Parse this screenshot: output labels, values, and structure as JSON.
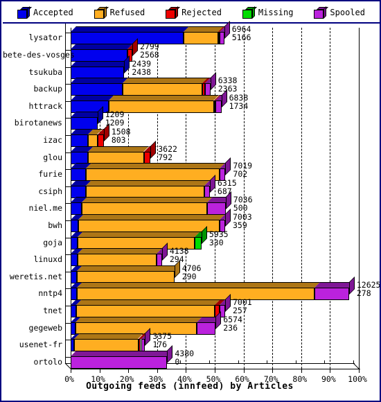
{
  "legend": {
    "items": [
      {
        "label": "Accepted",
        "color": "#0000ee",
        "icon": "cube-icon"
      },
      {
        "label": "Refused",
        "color": "#ffae21",
        "icon": "cube-icon"
      },
      {
        "label": "Rejected",
        "color": "#ee0000",
        "icon": "cube-icon"
      },
      {
        "label": "Missing",
        "color": "#00dd00",
        "icon": "cube-icon"
      },
      {
        "label": "Spooled",
        "color": "#bb22dd",
        "icon": "cube-icon"
      }
    ]
  },
  "chart_data": {
    "type": "bar",
    "orientation": "horizontal",
    "stacked": true,
    "title": "",
    "xlabel": "Outgoing feeds (innfeed) by Articles",
    "ylabel": "",
    "xlim": [
      0,
      100
    ],
    "xunit": "%",
    "grid": true,
    "legend_position": "top",
    "xticks": [
      "0%",
      "10%",
      "20%",
      "30%",
      "40%",
      "50%",
      "60%",
      "70%",
      "80%",
      "90%",
      "100%"
    ],
    "xtick_values": [
      0,
      10,
      20,
      30,
      40,
      50,
      60,
      70,
      80,
      90,
      100
    ],
    "series_names": [
      "Accepted",
      "Refused",
      "Rejected",
      "Missing",
      "Spooled"
    ],
    "categories": [
      "lysator",
      "bete-des-vosges",
      "tsukuba",
      "backup",
      "httrack",
      "birotanews",
      "izac",
      "glou",
      "furie",
      "csiph",
      "niel.me",
      "bwh",
      "goja",
      "linuxd",
      "weretis.net",
      "nntp4",
      "tnet",
      "gegeweb",
      "usenet-fr",
      "ortolo"
    ],
    "rows": [
      {
        "name": "lysator",
        "label_top": "6964",
        "label_bottom": "5166",
        "total_pct": 53.3,
        "segments": [
          {
            "series": "Accepted",
            "pct": 39.1
          },
          {
            "series": "Refused",
            "pct": 12.2
          },
          {
            "series": "Rejected",
            "pct": 0.4
          },
          {
            "series": "Spooled",
            "pct": 1.6
          }
        ]
      },
      {
        "name": "bete-des-vosges",
        "label_top": "2799",
        "label_bottom": "2568",
        "total_pct": 21.4,
        "segments": [
          {
            "series": "Accepted",
            "pct": 19.6
          },
          {
            "series": "Rejected",
            "pct": 1.8
          }
        ]
      },
      {
        "name": "tsukuba",
        "label_top": "2439",
        "label_bottom": "2438",
        "total_pct": 18.6,
        "segments": [
          {
            "series": "Accepted",
            "pct": 18.6
          }
        ]
      },
      {
        "name": "backup",
        "label_top": "6338",
        "label_bottom": "2363",
        "total_pct": 48.5,
        "segments": [
          {
            "series": "Accepted",
            "pct": 18.1
          },
          {
            "series": "Refused",
            "pct": 27.6
          },
          {
            "series": "Rejected",
            "pct": 1.0
          },
          {
            "series": "Spooled",
            "pct": 1.8
          }
        ]
      },
      {
        "name": "httrack",
        "label_top": "6838",
        "label_bottom": "1734",
        "total_pct": 52.3,
        "segments": [
          {
            "series": "Accepted",
            "pct": 13.3
          },
          {
            "series": "Refused",
            "pct": 36.4
          },
          {
            "series": "Rejected",
            "pct": 0.4
          },
          {
            "series": "Spooled",
            "pct": 2.2
          }
        ]
      },
      {
        "name": "birotanews",
        "label_top": "1209",
        "label_bottom": "1209",
        "total_pct": 9.3,
        "segments": [
          {
            "series": "Accepted",
            "pct": 9.3
          }
        ]
      },
      {
        "name": "izac",
        "label_top": "1508",
        "label_bottom": "803",
        "total_pct": 11.5,
        "segments": [
          {
            "series": "Accepted",
            "pct": 6.1
          },
          {
            "series": "Refused",
            "pct": 3.2
          },
          {
            "series": "Rejected",
            "pct": 2.2
          }
        ]
      },
      {
        "name": "glou",
        "label_top": "3622",
        "label_bottom": "792",
        "total_pct": 27.7,
        "segments": [
          {
            "series": "Accepted",
            "pct": 6.1
          },
          {
            "series": "Refused",
            "pct": 19.3
          },
          {
            "series": "Rejected",
            "pct": 2.3
          }
        ]
      },
      {
        "name": "furie",
        "label_top": "7019",
        "label_bottom": "702",
        "total_pct": 53.7,
        "segments": [
          {
            "series": "Accepted",
            "pct": 5.4
          },
          {
            "series": "Refused",
            "pct": 46.4
          },
          {
            "series": "Spooled",
            "pct": 1.9
          }
        ]
      },
      {
        "name": "csiph",
        "label_top": "6315",
        "label_bottom": "687",
        "total_pct": 48.3,
        "segments": [
          {
            "series": "Accepted",
            "pct": 5.3
          },
          {
            "series": "Refused",
            "pct": 41.2
          },
          {
            "series": "Spooled",
            "pct": 1.8
          }
        ]
      },
      {
        "name": "niel.me",
        "label_top": "7036",
        "label_bottom": "500",
        "total_pct": 53.8,
        "segments": [
          {
            "series": "Accepted",
            "pct": 3.8
          },
          {
            "series": "Refused",
            "pct": 43.6
          },
          {
            "series": "Spooled",
            "pct": 6.4
          }
        ]
      },
      {
        "name": "bwh",
        "label_top": "7003",
        "label_bottom": "359",
        "total_pct": 53.6,
        "segments": [
          {
            "series": "Accepted",
            "pct": 2.7
          },
          {
            "series": "Refused",
            "pct": 49.1
          },
          {
            "series": "Spooled",
            "pct": 1.8
          }
        ]
      },
      {
        "name": "goja",
        "label_top": "5935",
        "label_bottom": "330",
        "total_pct": 45.4,
        "segments": [
          {
            "series": "Accepted",
            "pct": 2.5
          },
          {
            "series": "Refused",
            "pct": 40.6
          },
          {
            "series": "Missing",
            "pct": 2.3
          }
        ]
      },
      {
        "name": "linuxd",
        "label_top": "4138",
        "label_bottom": "294",
        "total_pct": 31.7,
        "segments": [
          {
            "series": "Accepted",
            "pct": 2.3
          },
          {
            "series": "Refused",
            "pct": 27.5
          },
          {
            "series": "Spooled",
            "pct": 1.9
          }
        ]
      },
      {
        "name": "weretis.net",
        "label_top": "4706",
        "label_bottom": "290",
        "total_pct": 36.0,
        "segments": [
          {
            "series": "Accepted",
            "pct": 2.2
          },
          {
            "series": "Refused",
            "pct": 33.8
          }
        ]
      },
      {
        "name": "nntp4",
        "label_top": "12625",
        "label_bottom": "278",
        "total_pct": 96.6,
        "segments": [
          {
            "series": "Accepted",
            "pct": 2.1
          },
          {
            "series": "Refused",
            "pct": 82.5
          },
          {
            "series": "Spooled",
            "pct": 12.0
          }
        ]
      },
      {
        "name": "tnet",
        "label_top": "7001",
        "label_bottom": "257",
        "total_pct": 53.6,
        "segments": [
          {
            "series": "Accepted",
            "pct": 2.0
          },
          {
            "series": "Refused",
            "pct": 48.0
          },
          {
            "series": "Rejected",
            "pct": 1.6
          },
          {
            "series": "Spooled",
            "pct": 2.0
          }
        ]
      },
      {
        "name": "gegeweb",
        "label_top": "6574",
        "label_bottom": "236",
        "total_pct": 50.3,
        "segments": [
          {
            "series": "Accepted",
            "pct": 1.8
          },
          {
            "series": "Refused",
            "pct": 42.0
          },
          {
            "series": "Spooled",
            "pct": 6.5
          }
        ]
      },
      {
        "name": "usenet-fr",
        "label_top": "3375",
        "label_bottom": "176",
        "total_pct": 25.8,
        "segments": [
          {
            "series": "Accepted",
            "pct": 1.3
          },
          {
            "series": "Refused",
            "pct": 22.2
          },
          {
            "series": "Rejected",
            "pct": 0.9
          },
          {
            "series": "Spooled",
            "pct": 1.4
          }
        ]
      },
      {
        "name": "ortolo",
        "label_top": "4380",
        "label_bottom": "0",
        "total_pct": 33.5,
        "segments": [
          {
            "series": "Spooled",
            "pct": 33.5
          }
        ]
      }
    ]
  },
  "colors": {
    "Accepted": "#0000ee",
    "Refused": "#ffae21",
    "Rejected": "#ee0000",
    "Missing": "#00dd00",
    "Spooled": "#bb22dd",
    "border": "#000080",
    "axis": "#000000",
    "background": "#ffffff"
  }
}
